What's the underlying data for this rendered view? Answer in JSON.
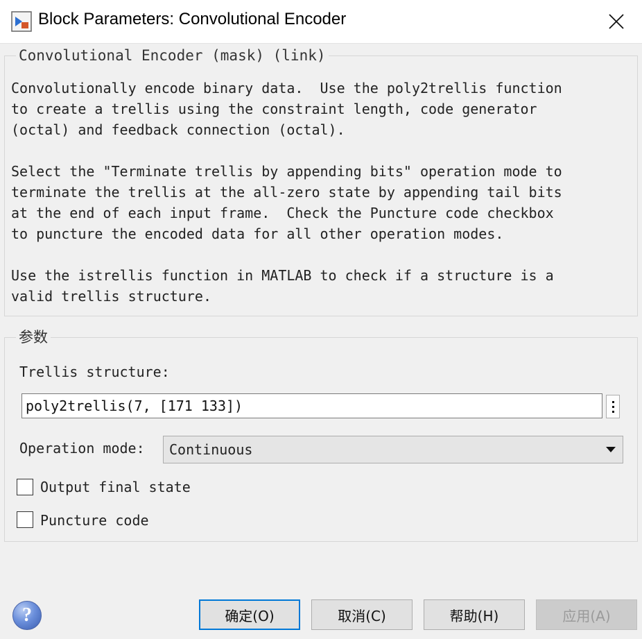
{
  "window": {
    "title": "Block Parameters: Convolutional Encoder",
    "icon": "simulink-block-icon",
    "close_icon": "close-icon"
  },
  "description": {
    "legend": "Convolutional Encoder (mask) (link)",
    "paragraph1": "Convolutionally encode binary data.  Use the poly2trellis function\nto create a trellis using the constraint length, code generator\n(octal) and feedback connection (octal).",
    "paragraph2": "Select the \"Terminate trellis by appending bits\" operation mode to\nterminate the trellis at the all-zero state by appending tail bits\nat the end of each input frame.  Check the Puncture code checkbox\nto puncture the encoded data for all other operation modes.",
    "paragraph3": "Use the istrellis function in MATLAB to check if a structure is a\nvalid trellis structure."
  },
  "parameters": {
    "legend": "参数",
    "trellis_label": "Trellis structure:",
    "trellis_value": "poly2trellis(7, [171 133])",
    "operation_label": "Operation mode:",
    "operation_value": "Continuous",
    "output_final_state_label": "Output final state",
    "output_final_state_checked": false,
    "puncture_code_label": "Puncture code",
    "puncture_code_checked": false
  },
  "buttons": {
    "ok": "确定(O)",
    "cancel": "取消(C)",
    "help": "帮助(H)",
    "apply": "应用(A)"
  },
  "colors": {
    "primary_border": "#0078d7",
    "background": "#f0f0f0"
  }
}
